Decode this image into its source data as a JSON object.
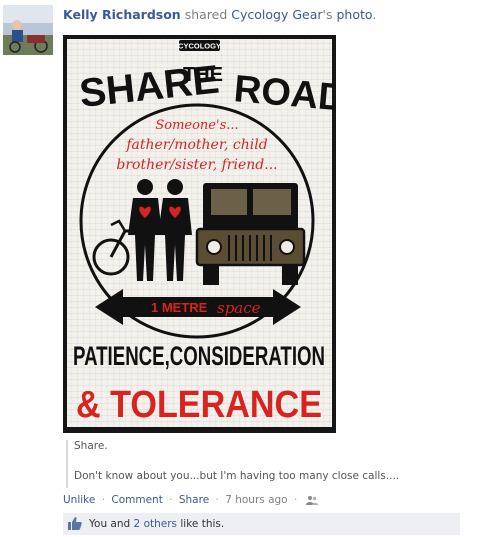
{
  "post": {
    "author": "Kelly Richardson",
    "verb": "shared",
    "page_name": "Cycology Gear",
    "possessive": "'s",
    "object": "photo",
    "period": "."
  },
  "poster": {
    "brand": "CYCOLOGY",
    "title_share": "SHARE",
    "title_the": "THE",
    "title_road": "ROAD",
    "script_line1": "Someone's...",
    "script_line2": "father/mother, child",
    "script_line3": "brother/sister, friend...",
    "metre_bold": "1 METRE",
    "metre_script": "space",
    "line_patience": "PATIENCE,CONSIDERATION",
    "line_tolerance": "& TOLERANCE"
  },
  "caption": {
    "line1": "Share.",
    "line2": "Don't know about you...but I'm having too many close calls...."
  },
  "actions": {
    "unlike": "Unlike",
    "comment": "Comment",
    "share": "Share",
    "sep": "·",
    "timestamp": "7 hours ago",
    "audience_icon": "people-icon"
  },
  "likes": {
    "prefix": "You and",
    "others": "2 others",
    "suffix": "like this.",
    "icon": "thumbs-up-icon"
  },
  "colors": {
    "link": "#3b5998",
    "poster_red": "#d9231f",
    "poster_black": "#111111",
    "likes_bg": "#edeff4"
  }
}
